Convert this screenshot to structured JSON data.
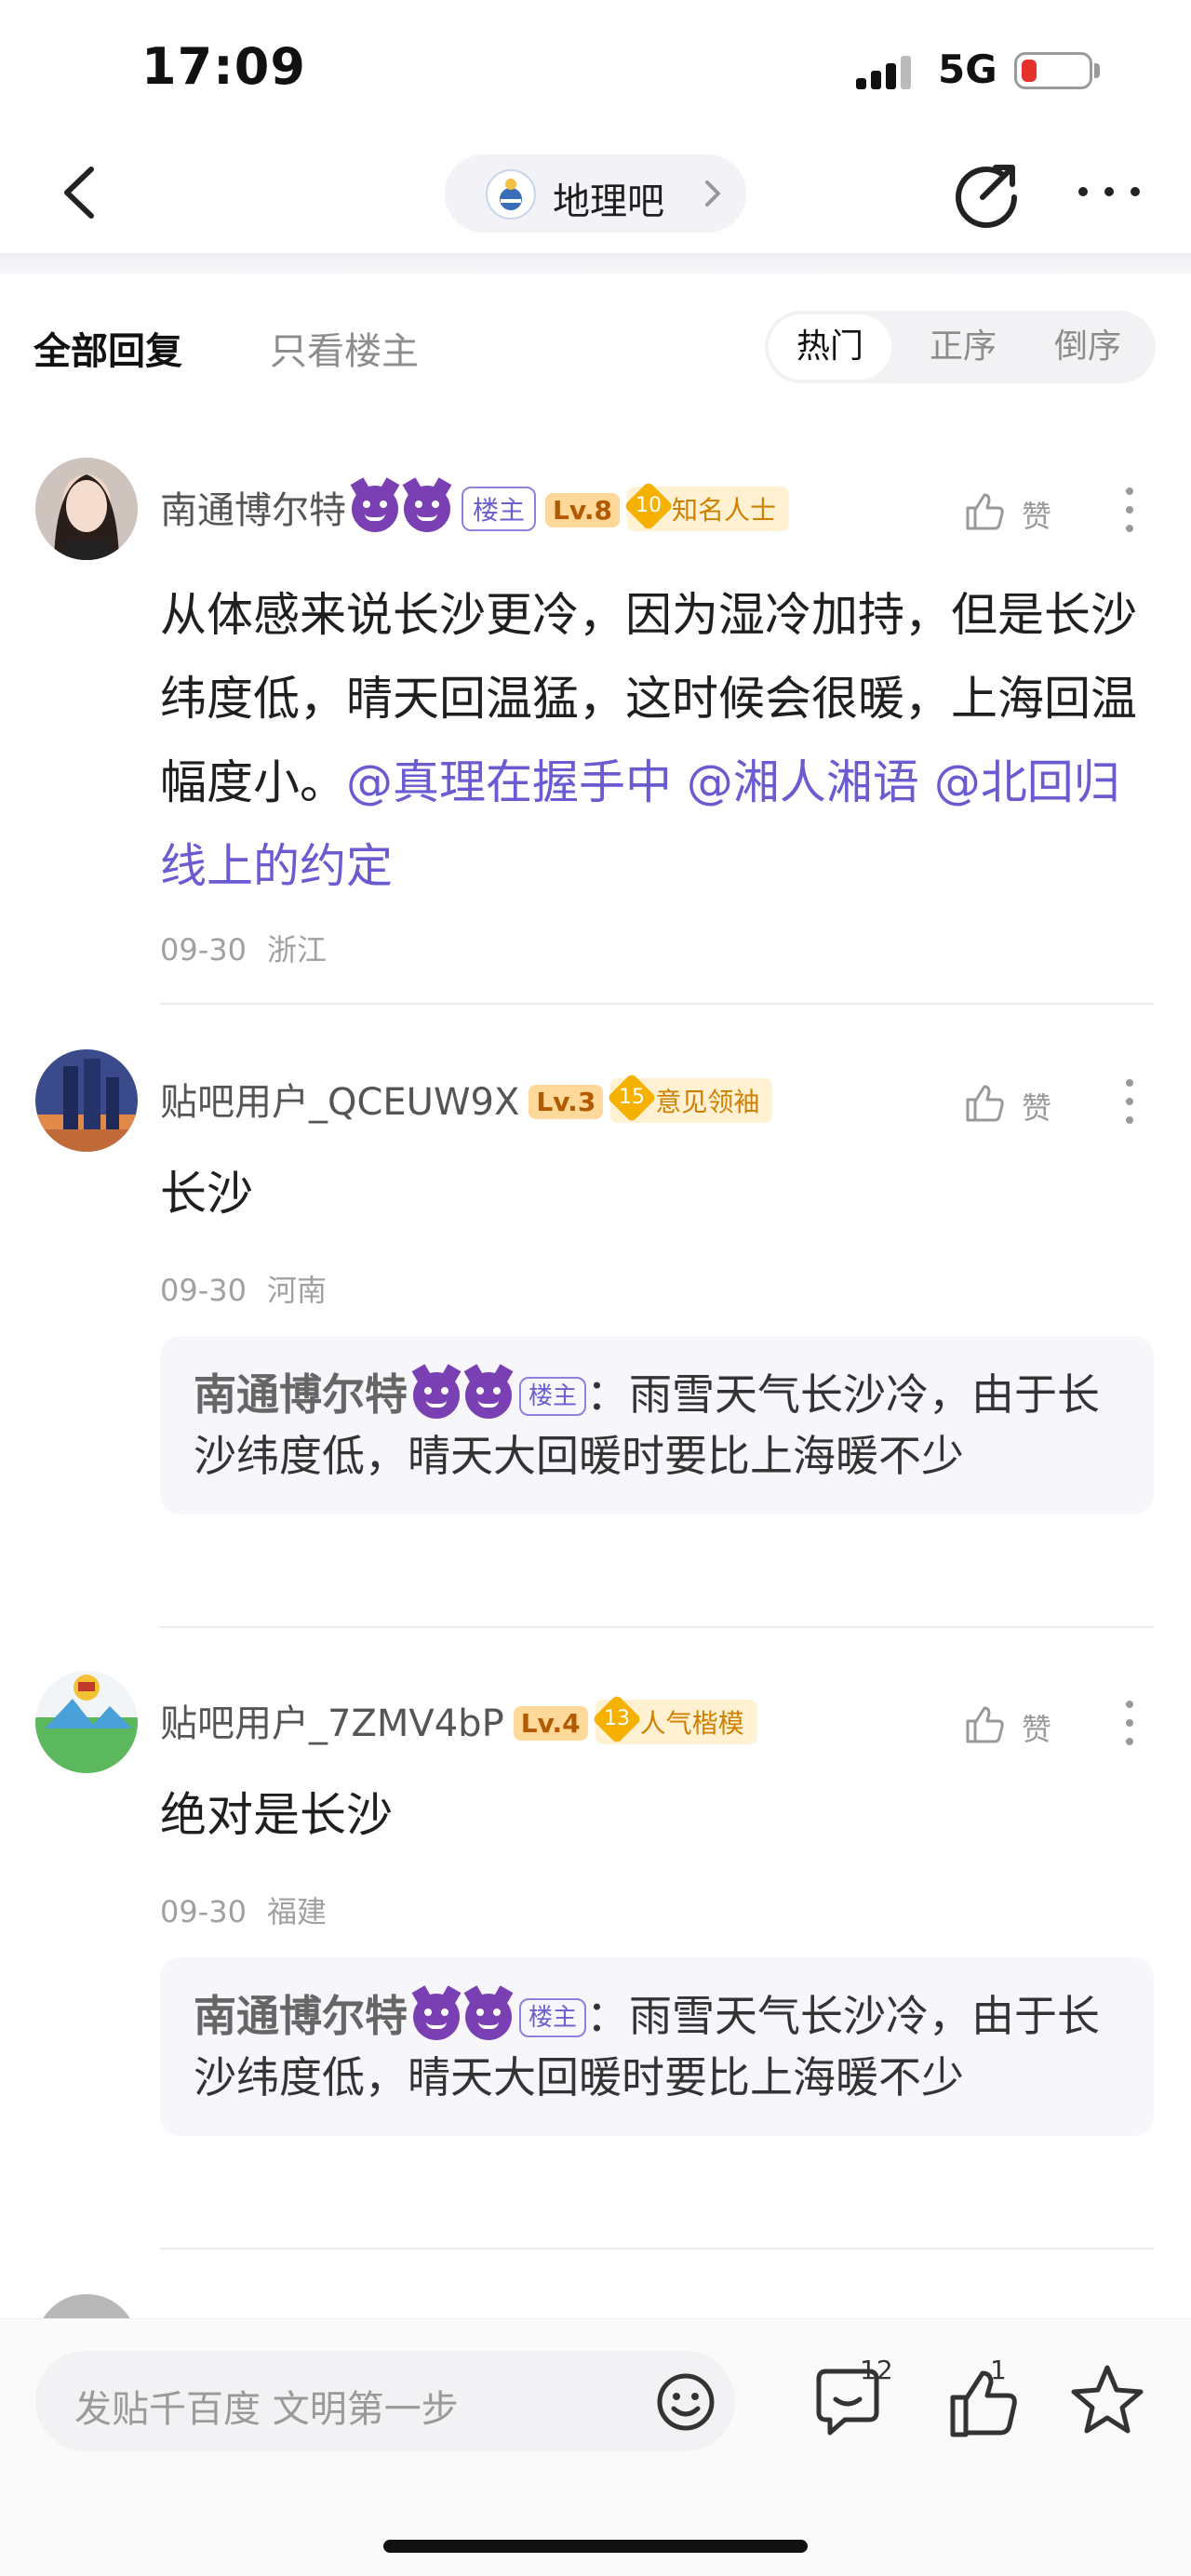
{
  "status_bar": {
    "time": "17:09",
    "network": "5G"
  },
  "header": {
    "forum_name": "地理吧"
  },
  "filter": {
    "tab_all": "全部回复",
    "tab_op_only": "只看楼主",
    "sort_options": [
      "热门",
      "正序",
      "倒序"
    ],
    "active_sort": "热门"
  },
  "posts": [
    {
      "username": "南通博尔特",
      "emojis": [
        "smiling-devil-emoji",
        "smiling-devil-emoji"
      ],
      "op_badge": "楼主",
      "level": "Lv.8",
      "honor_level": "10",
      "honor_title": "知名人士",
      "like_label": "赞",
      "text_main": "从体感来说长沙更冷，因为湿冷加持，但是长沙纬度低，晴天回温猛，这时候会很暖，上海回温幅度小。",
      "mentions": [
        "@真理在握手中",
        "@湘人湘语",
        "@北回归线上的约定"
      ],
      "date": "09-30",
      "location": "浙江"
    },
    {
      "username": "贴吧用户_QCEUW9X",
      "level": "Lv.3",
      "honor_level": "15",
      "honor_title": "意见领袖",
      "like_label": "赞",
      "text": "长沙",
      "date": "09-30",
      "location": "河南",
      "quote": {
        "username": "南通博尔特",
        "op_badge": "楼主",
        "text": "：雨雪天气长沙冷，由于长沙纬度低，晴天大回暖时要比上海暖不少"
      }
    },
    {
      "username": "贴吧用户_7ZMV4bP",
      "level": "Lv.4",
      "honor_level": "13",
      "honor_title": "人气楷模",
      "like_label": "赞",
      "text": "绝对是长沙",
      "date": "09-30",
      "location": "福建",
      "quote": {
        "username": "南通博尔特",
        "op_badge": "楼主",
        "text": "：雨雪天气长沙冷，由于长沙纬度低，晴天大回暖时要比上海暖不少"
      }
    }
  ],
  "bottom_bar": {
    "reply_placeholder": "发贴千百度 文明第一步",
    "comment_count": "12",
    "like_count": "1"
  },
  "colors": {
    "mention": "#6a5bd0",
    "level_badge": "#ffd89a",
    "honor_badge": "#fff1d2",
    "battery_low": "#e5312c"
  }
}
